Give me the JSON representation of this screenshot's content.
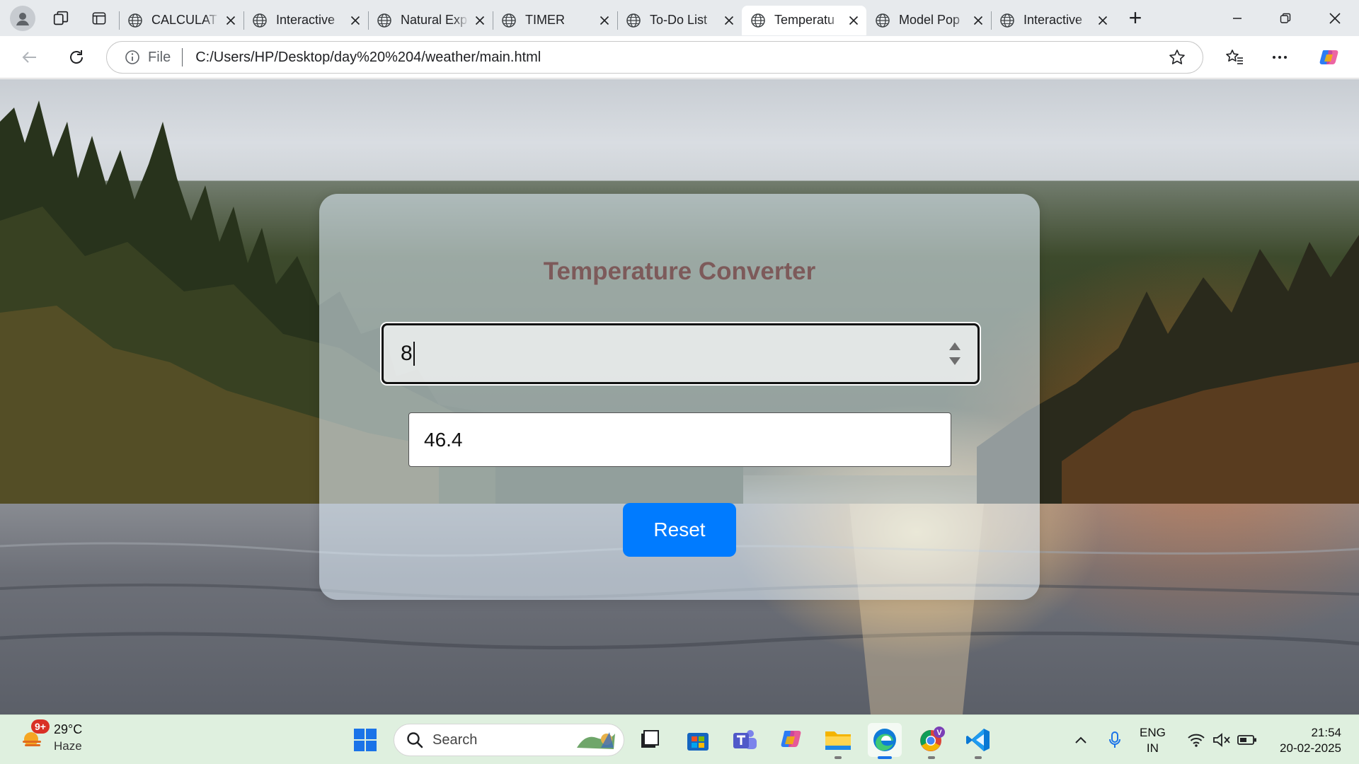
{
  "browser": {
    "tabs": [
      {
        "title": "CALCULAT",
        "active": false
      },
      {
        "title": "Interactive",
        "active": false
      },
      {
        "title": "Natural Exp",
        "active": false
      },
      {
        "title": "TIMER",
        "active": false
      },
      {
        "title": "To-Do List",
        "active": false
      },
      {
        "title": "Temperatu",
        "active": true
      },
      {
        "title": "Model Pop",
        "active": false
      },
      {
        "title": "Interactive",
        "active": false
      }
    ],
    "address": {
      "scheme_label": "File",
      "url": "C:/Users/HP/Desktop/day%20%204/weather/main.html"
    }
  },
  "page": {
    "title": "Temperature Converter",
    "celsius_value": "8",
    "fahrenheit_value": "46.4",
    "reset_label": "Reset",
    "reset_color": "#007bff",
    "title_color": "#7d5a5a"
  },
  "taskbar": {
    "weather": {
      "badge": "9+",
      "temp": "29°C",
      "condition": "Haze"
    },
    "search_label": "Search",
    "language": {
      "line1": "ENG",
      "line2": "IN"
    },
    "clock": {
      "time": "21:54",
      "date": "20-02-2025"
    },
    "pinned_icons": [
      "start-icon",
      "search-icon",
      "task-view-icon",
      "microsoft-store-icon",
      "teams-icon",
      "copilot-icon",
      "file-explorer-icon",
      "edge-icon",
      "chrome-icon",
      "vscode-icon"
    ]
  }
}
